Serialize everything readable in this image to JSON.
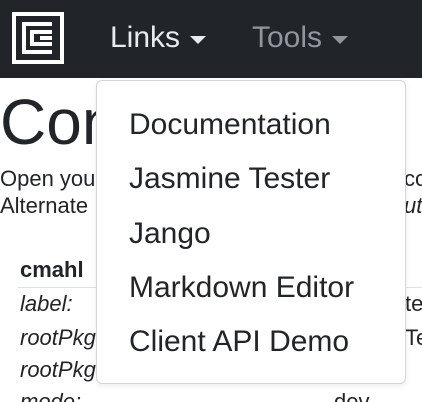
{
  "navbar": {
    "background": "#212529",
    "brand_icon": "app-logo-icon",
    "links_label": "Links",
    "tools_label": "Tools"
  },
  "main": {
    "title": "Con",
    "intro_line_1": "Open you",
    "intro_line_1_right": "co",
    "intro_line_2": "Alternate",
    "intro_line_2_right": "ut",
    "config": {
      "heading": "cmahl",
      "rows": [
        {
          "key": "label:",
          "value": "te"
        },
        {
          "key": "rootPkg",
          "value": "Te"
        },
        {
          "key": "rootPkg",
          "value": ""
        },
        {
          "key": "mode:",
          "value": "dev"
        }
      ]
    }
  },
  "dropdown": {
    "items": [
      "Documentation",
      "Jasmine Tester",
      "Jango",
      "Markdown Editor",
      "Client API Demo"
    ]
  }
}
